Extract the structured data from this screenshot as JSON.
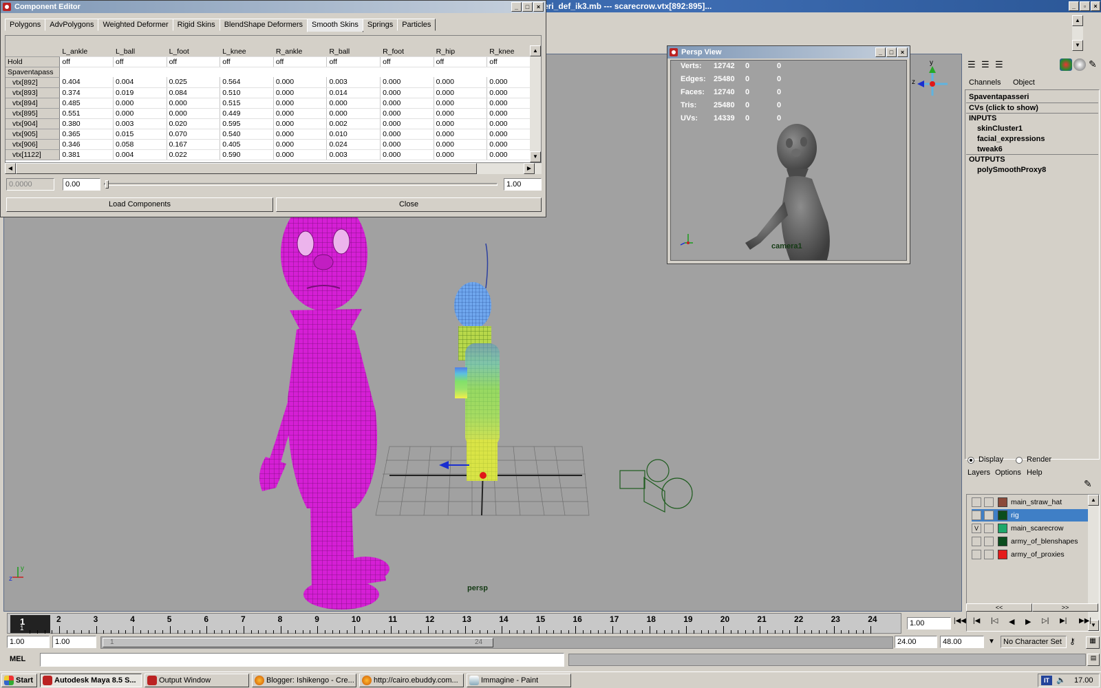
{
  "main_window": {
    "title": "eri_def_ik3.mb  ---  scarecrow.vtx[892:895]..."
  },
  "component_editor": {
    "title": "Component Editor",
    "tabs": [
      "Polygons",
      "AdvPolygons",
      "Weighted Deformer",
      "Rigid Skins",
      "BlendShape Deformers",
      "Smooth Skins",
      "Springs",
      "Particles"
    ],
    "active_tab": "Smooth Skins",
    "columns": [
      "L_ankle",
      "L_ball",
      "L_foot",
      "L_knee",
      "R_ankle",
      "R_ball",
      "R_foot",
      "R_hip",
      "R_knee"
    ],
    "hold_label": "Hold",
    "hold_values": [
      "off",
      "off",
      "off",
      "off",
      "off",
      "off",
      "off",
      "off",
      "off"
    ],
    "group_label": "Spaventapass",
    "rows": [
      {
        "name": "vtx[892]",
        "values": [
          "0.404",
          "0.004",
          "0.025",
          "0.564",
          "0.000",
          "0.003",
          "0.000",
          "0.000",
          "0.000"
        ]
      },
      {
        "name": "vtx[893]",
        "values": [
          "0.374",
          "0.019",
          "0.084",
          "0.510",
          "0.000",
          "0.014",
          "0.000",
          "0.000",
          "0.000"
        ]
      },
      {
        "name": "vtx[894]",
        "values": [
          "0.485",
          "0.000",
          "0.000",
          "0.515",
          "0.000",
          "0.000",
          "0.000",
          "0.000",
          "0.000"
        ]
      },
      {
        "name": "vtx[895]",
        "values": [
          "0.551",
          "0.000",
          "0.000",
          "0.449",
          "0.000",
          "0.000",
          "0.000",
          "0.000",
          "0.000"
        ]
      },
      {
        "name": "vtx[904]",
        "values": [
          "0.380",
          "0.003",
          "0.020",
          "0.595",
          "0.000",
          "0.002",
          "0.000",
          "0.000",
          "0.000"
        ]
      },
      {
        "name": "vtx[905]",
        "values": [
          "0.365",
          "0.015",
          "0.070",
          "0.540",
          "0.000",
          "0.010",
          "0.000",
          "0.000",
          "0.000"
        ]
      },
      {
        "name": "vtx[906]",
        "values": [
          "0.346",
          "0.058",
          "0.167",
          "0.405",
          "0.000",
          "0.024",
          "0.000",
          "0.000",
          "0.000"
        ]
      },
      {
        "name": "vtx[1122]",
        "values": [
          "0.381",
          "0.004",
          "0.022",
          "0.590",
          "0.000",
          "0.003",
          "0.000",
          "0.000",
          "0.000"
        ]
      }
    ],
    "value_field": "0.0000",
    "slider_min": "0.00",
    "slider_max": "1.00",
    "load_button": "Load Components",
    "close_button": "Close"
  },
  "persp_view": {
    "title": "Persp View",
    "stats": [
      {
        "label": "Verts:",
        "v1": "12742",
        "v2": "0",
        "v3": "0"
      },
      {
        "label": "Edges:",
        "v1": "25480",
        "v2": "0",
        "v3": "0"
      },
      {
        "label": "Faces:",
        "v1": "12740",
        "v2": "0",
        "v3": "0"
      },
      {
        "label": "Tris:",
        "v1": "25480",
        "v2": "0",
        "v3": "0"
      },
      {
        "label": "UVs:",
        "v1": "14339",
        "v2": "0",
        "v3": "0"
      }
    ],
    "camera_label": "camera1"
  },
  "viewport": {
    "camera_label": "persp"
  },
  "channel_box": {
    "menu": [
      "Channels",
      "Object"
    ],
    "object_name": "Spaventapasseri",
    "cvs_label": "CVs (click to show)",
    "inputs_header": "INPUTS",
    "inputs": [
      "skinCluster1",
      "facial_expressions",
      "tweak6"
    ],
    "outputs_header": "OUTPUTS",
    "outputs": [
      "polySmoothProxy8"
    ]
  },
  "layer_editor": {
    "display_label": "Display",
    "render_label": "Render",
    "menu": [
      "Layers",
      "Options",
      "Help"
    ],
    "layers": [
      {
        "name": "main_straw_hat",
        "visible": "",
        "color": "#8b4a3a"
      },
      {
        "name": "rig",
        "visible": "",
        "color": "#0b4d1e"
      },
      {
        "name": "main_scarecrow",
        "visible": "V",
        "color": "#1ea86b"
      },
      {
        "name": "army_of_blenshapes",
        "visible": "",
        "color": "#0b4d1e"
      },
      {
        "name": "army_of_proxies",
        "visible": "",
        "color": "#e41b1b"
      }
    ],
    "selected_layer": "rig"
  },
  "timeline": {
    "ticks": [
      "1",
      "2",
      "3",
      "4",
      "5",
      "6",
      "7",
      "8",
      "9",
      "10",
      "11",
      "12",
      "13",
      "14",
      "15",
      "16",
      "17",
      "18",
      "19",
      "20",
      "21",
      "22",
      "23",
      "24"
    ],
    "current_frame": "1.00",
    "current_marker": "1"
  },
  "range_slider": {
    "start": "1.00",
    "playback_start": "1.00",
    "slider_start": "1",
    "slider_end": "24",
    "playback_end": "24.00",
    "end": "48.00",
    "character_set": "No Character Set"
  },
  "command_line": {
    "label": "MEL"
  },
  "taskbar": {
    "start": "Start",
    "tasks": [
      {
        "label": "Autodesk Maya 8.5 S...",
        "active": true
      },
      {
        "label": "Output Window"
      },
      {
        "label": "Blogger: Ishikengo - Cre..."
      },
      {
        "label": "http://cairo.ebuddy.com..."
      },
      {
        "label": "Immagine - Paint"
      }
    ],
    "lang": "IT",
    "clock": "17.00"
  },
  "colors": {
    "viewport_bg": "#a1a1a1",
    "magenta_wire": "#e020e0",
    "selection_blue": "#3f7fc6"
  }
}
